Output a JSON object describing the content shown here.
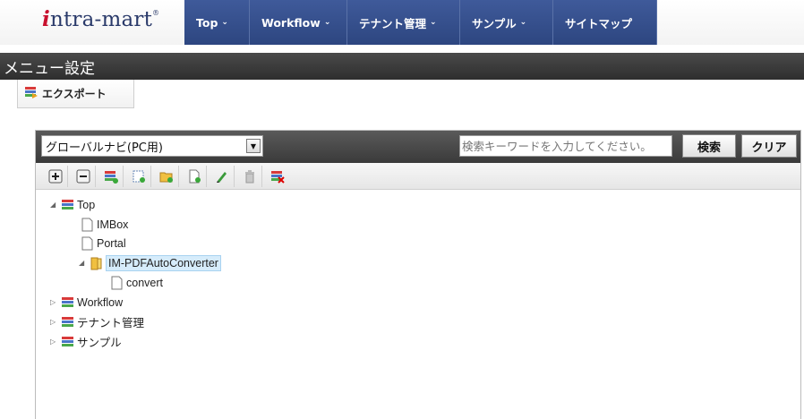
{
  "brand": {
    "logo_prefix": "i",
    "logo_rest": "ntra-mart",
    "logo_mark": "®"
  },
  "nav": {
    "items": [
      {
        "label": "Top",
        "caret": "⌄"
      },
      {
        "label": "Workflow",
        "caret": "⌄"
      },
      {
        "label": "テナント管理",
        "caret": "⌄"
      },
      {
        "label": "サンプル",
        "caret": "⌄"
      },
      {
        "label": "サイトマップ",
        "caret": ""
      }
    ]
  },
  "page": {
    "title": "メニュー設定"
  },
  "subtoolbar": {
    "export_label": "エクスポート"
  },
  "search": {
    "menu_group": "グローバルナビ(PC用)",
    "placeholder": "検索キーワードを入力してください。",
    "search_button": "検索",
    "clear_button": "クリア"
  },
  "toolbar_icons": [
    "expand-all-icon",
    "collapse-all-icon",
    "add-category-icon",
    "add-page-icon",
    "add-folder-icon",
    "new-item-icon",
    "edit-icon",
    "delete-icon",
    "disable-icon"
  ],
  "tree": [
    {
      "label": "Top",
      "type": "category",
      "state": "expanded",
      "depth": 0
    },
    {
      "label": "IMBox",
      "type": "page",
      "state": "leaf",
      "depth": 1
    },
    {
      "label": "Portal",
      "type": "page",
      "state": "leaf",
      "depth": 1
    },
    {
      "label": "IM-PDFAutoConverter",
      "type": "folder",
      "state": "expanded",
      "depth": 1,
      "selected": true
    },
    {
      "label": "convert",
      "type": "page",
      "state": "leaf",
      "depth": 2
    },
    {
      "label": "Workflow",
      "type": "category",
      "state": "collapsed",
      "depth": 0
    },
    {
      "label": "テナント管理",
      "type": "category",
      "state": "collapsed",
      "depth": 0
    },
    {
      "label": "サンプル",
      "type": "category",
      "state": "collapsed",
      "depth": 0
    }
  ],
  "colors": {
    "nav_bg": "#34508c",
    "title_bg": "#3a3a3a",
    "search_bar_bg": "#4a4a4a",
    "selection": "#d6ecfb"
  }
}
